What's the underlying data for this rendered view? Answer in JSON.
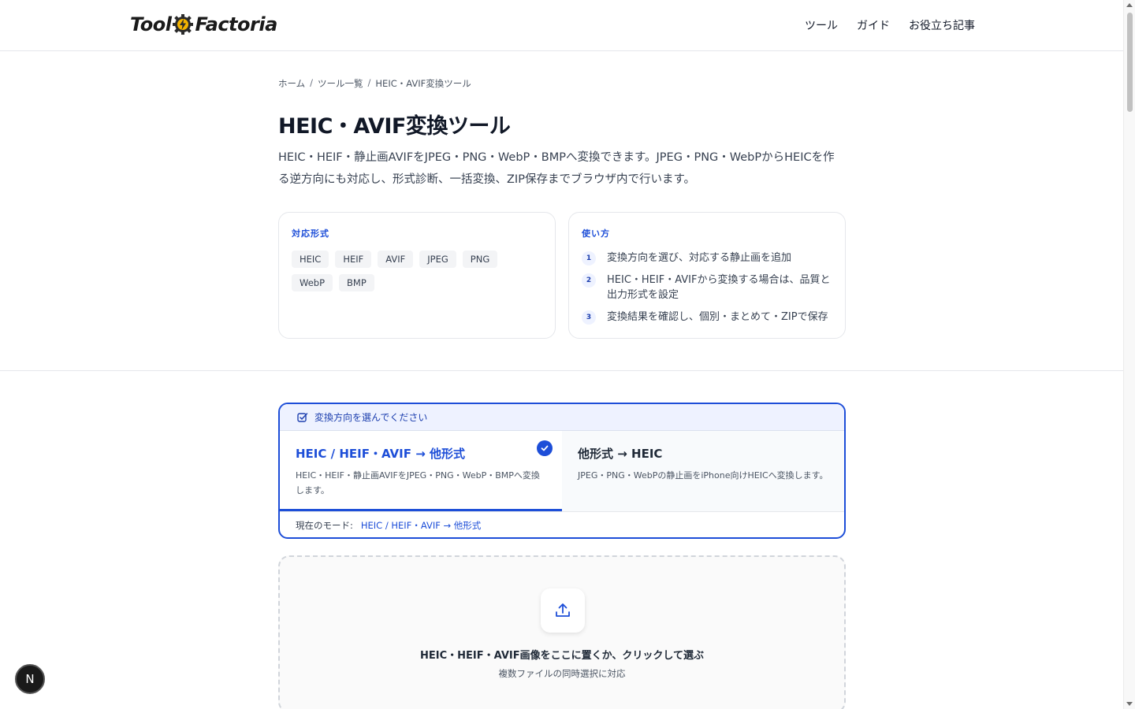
{
  "header": {
    "logo_left": "Tool",
    "logo_right": "Factoria",
    "nav": [
      "ツール",
      "ガイド",
      "お役立ち記事"
    ]
  },
  "breadcrumb": [
    "ホーム",
    "ツール一覧",
    "HEIC・AVIF変換ツール"
  ],
  "page": {
    "title": "HEIC・AVIF変換ツール",
    "description": "HEIC・HEIF・静止画AVIFをJPEG・PNG・WebP・BMPへ変換できます。JPEG・PNG・WebPからHEICを作る逆方向にも対応し、形式診断、一括変換、ZIP保存までブラウザ内で行います。"
  },
  "formats_card": {
    "title": "対応形式",
    "formats": [
      "HEIC",
      "HEIF",
      "AVIF",
      "JPEG",
      "PNG",
      "WebP",
      "BMP"
    ]
  },
  "usage_card": {
    "title": "使い方",
    "steps": [
      {
        "num": "1",
        "text": "変換方向を選び、対応する静止画を追加"
      },
      {
        "num": "2",
        "text": "HEIC・HEIF・AVIFから変換する場合は、品質と出力形式を設定"
      },
      {
        "num": "3",
        "text": "変換結果を確認し、個別・まとめて・ZIPで保存"
      }
    ]
  },
  "mode": {
    "header": "変換方向を選んでください",
    "options": [
      {
        "title": "HEIC / HEIF・AVIF → 他形式",
        "desc": "HEIC・HEIF・静止画AVIFをJPEG・PNG・WebP・BMPへ変換します。"
      },
      {
        "title": "他形式 → HEIC",
        "desc": "JPEG・PNG・WebPの静止画をiPhone向けHEICへ変換します。"
      }
    ],
    "current_label": "現在のモード:",
    "current_value": "HEIC / HEIF・AVIF → 他形式"
  },
  "dropzone": {
    "title": "HEIC・HEIF・AVIF画像をここに置くか、クリックして選ぶ",
    "subtitle": "複数ファイルの同時選択に対応"
  },
  "badge": {
    "letter": "N"
  },
  "colors": {
    "accent": "#1d4ed8",
    "accent_light": "#eef2ff",
    "border": "#e5e7eb"
  }
}
